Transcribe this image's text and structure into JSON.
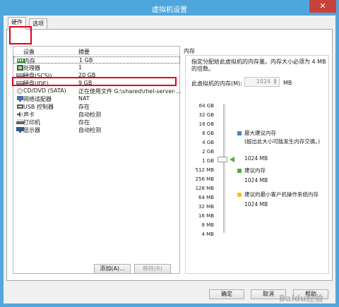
{
  "window": {
    "title": "虚拟机设置",
    "close_glyph": "✕"
  },
  "tabs": [
    {
      "label": "硬件"
    },
    {
      "label": "选项"
    }
  ],
  "device_list": {
    "col_device": "设备",
    "col_summary": "摘要",
    "rows": [
      {
        "name": "内存",
        "summary": "1 GB",
        "icon": "memory-icon"
      },
      {
        "name": "处理器",
        "summary": "1",
        "icon": "cpu-icon"
      },
      {
        "name": "硬盘(SCSI)",
        "summary": "20 GB",
        "icon": "disk-icon"
      },
      {
        "name": "硬盘(IDE)",
        "summary": "9 GB",
        "icon": "disk-icon"
      },
      {
        "name": "CD/DVD (SATA)",
        "summary": "正在使用文件 G:\\shared\\rhel-server-...",
        "icon": "cdrom-icon"
      },
      {
        "name": "网络适配器",
        "summary": "NAT",
        "icon": "network-icon"
      },
      {
        "name": "USB 控制器",
        "summary": "存在",
        "icon": "usb-icon"
      },
      {
        "name": "声卡",
        "summary": "自动检测",
        "icon": "sound-icon"
      },
      {
        "name": "打印机",
        "summary": "存在",
        "icon": "printer-icon"
      },
      {
        "name": "显示器",
        "summary": "自动检测",
        "icon": "monitor-icon"
      }
    ],
    "add_button": "添加(A)...",
    "remove_button": "移除(R)"
  },
  "memory": {
    "legend": "内存",
    "description": "指定分配给此虚拟机的内存量。内存大小必须为 4 MB 的倍数。",
    "field_label": "此虚拟机的内存(M):",
    "value": "1024",
    "unit": "MB",
    "ticks": [
      "64 GB",
      "32 GB",
      "16 GB",
      "8 GB",
      "4 GB",
      "2 GB",
      "1 GB",
      "512 MB",
      "256 MB",
      "128 MB",
      "64 MB",
      "32 MB",
      "16 MB",
      "8 MB",
      "4 MB"
    ],
    "max_recommended_label": "最大建议内存",
    "max_recommended_note": "(超出此大小可能发生内存交换。)",
    "max_recommended_value": "1024 MB",
    "recommended_label": "建议内存",
    "recommended_value": "1024 MB",
    "min_label": "建议的最小客户机操作系统内存",
    "min_value": "1024 MB",
    "colors": {
      "max": "#4a7fc1",
      "recommended": "#4caf33",
      "min": "#e8c32c"
    }
  },
  "footer": {
    "ok": "确定",
    "cancel": "取消",
    "help": "帮助"
  },
  "watermark": "Baidu经验"
}
